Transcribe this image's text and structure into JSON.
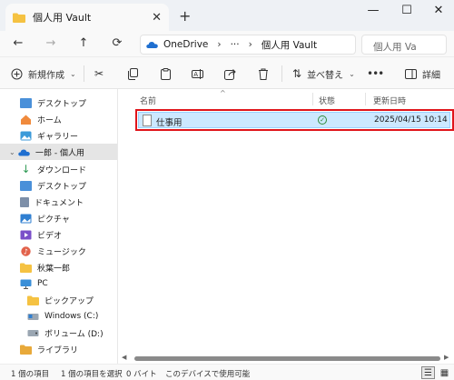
{
  "window": {
    "tab_title": "個人用 Vault",
    "new_tab": "+",
    "controls": {
      "minimize": "—",
      "maximize": "☐",
      "close": "✕"
    }
  },
  "nav": {
    "back": "←",
    "forward": "→",
    "up": "↑",
    "refresh": "⟳",
    "address": {
      "root": "OneDrive",
      "ellipsis": "···",
      "current": "個人用 Vault",
      "separator": "›"
    },
    "search_placeholder": "個人用 Va"
  },
  "toolbar": {
    "new_label": "新規作成",
    "sort_label": "並べ替え",
    "more": "•••",
    "details_label": "詳細"
  },
  "sidebar": {
    "items": [
      {
        "label": "デスクトップ",
        "icon": "desktop-icon"
      },
      {
        "label": "ホーム",
        "icon": "home-icon"
      },
      {
        "label": "ギャラリー",
        "icon": "gallery-icon"
      },
      {
        "label": "一郎 - 個人用",
        "icon": "onedrive-cloud-icon"
      },
      {
        "label": "ダウンロード",
        "icon": "download-icon"
      },
      {
        "label": "デスクトップ",
        "icon": "desktop-icon"
      },
      {
        "label": "ドキュメント",
        "icon": "documents-icon"
      },
      {
        "label": "ピクチャ",
        "icon": "pictures-icon"
      },
      {
        "label": "ビデオ",
        "icon": "video-icon"
      },
      {
        "label": "ミュージック",
        "icon": "music-icon"
      },
      {
        "label": "秋葉一郎",
        "icon": "folder-icon"
      },
      {
        "label": "PC",
        "icon": "pc-icon"
      },
      {
        "label": "ピックアップ",
        "icon": "folder-icon"
      },
      {
        "label": "Windows (C:)",
        "icon": "drive-icon"
      },
      {
        "label": "ボリューム (D:)",
        "icon": "drive-icon"
      },
      {
        "label": "ライブラリ",
        "icon": "library-icon"
      }
    ]
  },
  "main": {
    "columns": {
      "name": "名前",
      "status": "状態",
      "modified": "更新日時"
    },
    "sort_caret": "^",
    "rows": [
      {
        "name": "仕事用",
        "status_icon": "synced-check-icon",
        "modified": "2025/04/15 10:14"
      }
    ]
  },
  "statusbar": {
    "count": "1 個の項目",
    "selected": "1 個の項目を選択",
    "size": "0 バイト",
    "availability": "このデバイスで使用可能"
  },
  "colors": {
    "selection": "#cce8ff",
    "highlight_box": "#e0141b",
    "folder": "#f5c242",
    "onedrive": "#1f6fd0"
  }
}
